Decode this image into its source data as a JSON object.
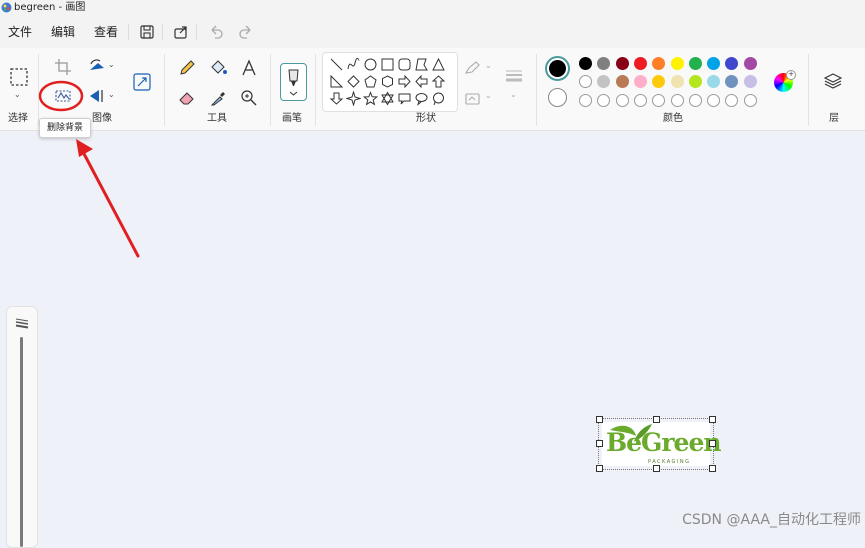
{
  "window": {
    "title": "begreen - 画图"
  },
  "menu": {
    "items": [
      "文件",
      "编辑",
      "查看"
    ]
  },
  "ribbon": {
    "groups": {
      "select": "选择",
      "image": "图像",
      "tools": "工具",
      "brushes": "画笔",
      "shapes": "形状",
      "colors": "颜色",
      "layers": "层"
    }
  },
  "tooltip": {
    "text": "删除背景"
  },
  "colors": {
    "primary": "#000000",
    "secondary": "#ffffff",
    "row1": [
      "#000000",
      "#7f7f7f",
      "#880015",
      "#ed1c24",
      "#ff7f27",
      "#fff200",
      "#22b14c",
      "#00a2e8",
      "#3f48cc",
      "#a349a4"
    ],
    "row2": [
      "#ffffff",
      "#c3c3c3",
      "#b97a57",
      "#ffaec9",
      "#ffc90e",
      "#efe4b0",
      "#b5e61d",
      "#99d9ea",
      "#7092be",
      "#c8bfe7"
    ],
    "row3_empty_count": 10
  },
  "canvas": {
    "image_brand": "BeGreen",
    "image_subtitle": "PACKAGING"
  },
  "annotation": {
    "arrow_color": "#e02020"
  },
  "watermark": {
    "text": "CSDN @AAA_自动化工程师"
  }
}
